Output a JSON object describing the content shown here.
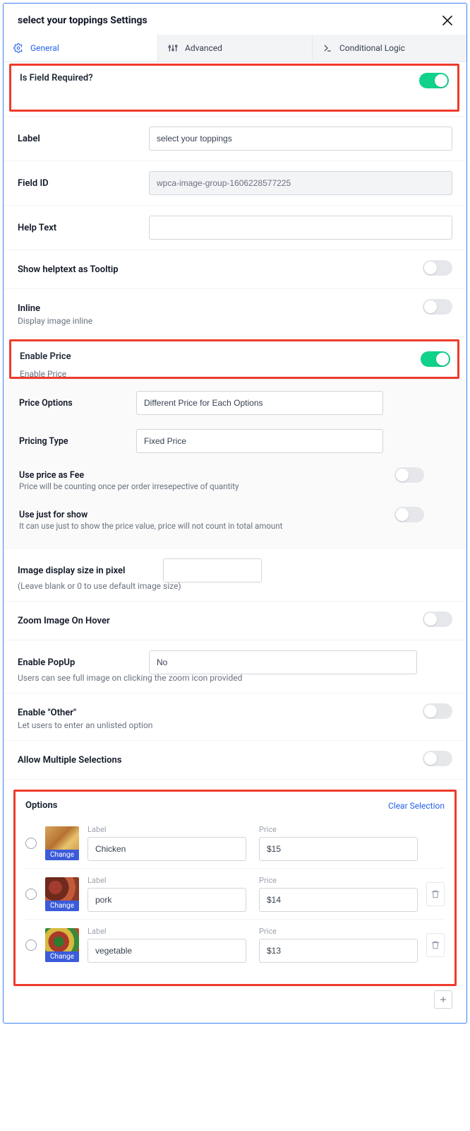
{
  "header": {
    "title": "select your toppings Settings"
  },
  "tabs": {
    "general": "General",
    "advanced": "Advanced",
    "conditional": "Conditional Logic"
  },
  "fields": {
    "required_label": "Is Field Required?",
    "required_on": true,
    "label_label": "Label",
    "label_value": "select your toppings",
    "fieldid_label": "Field ID",
    "fieldid_value": "wpca-image-group-1606228577225",
    "helptext_label": "Help Text",
    "helptext_value": "",
    "tooltip_label": "Show helptext as Tooltip",
    "tooltip_on": false,
    "inline_label": "Inline",
    "inline_help": "Display image inline",
    "inline_on": false,
    "enableprice_label": "Enable Price",
    "enableprice_help": "Enable Price",
    "enableprice_on": true,
    "price_options_label": "Price Options",
    "price_options_value": "Different Price for Each Options",
    "pricing_type_label": "Pricing Type",
    "pricing_type_value": "Fixed Price",
    "use_fee_label": "Use price as Fee",
    "use_fee_help": "Price will be counting once per order irresepective of quantity",
    "use_fee_on": false,
    "just_show_label": "Use just for show",
    "just_show_help": "It can use just to show the price value, price will not count in total amount",
    "just_show_on": false,
    "imgsize_label": "Image display size in pixel",
    "imgsize_help": "(Leave blank or 0 to use default image size)",
    "imgsize_value": "",
    "zoom_label": "Zoom Image On Hover",
    "zoom_on": false,
    "popup_label": "Enable PopUp",
    "popup_value": "No",
    "popup_help": "Users can see full image on clicking the zoom icon provided",
    "other_label": "Enable \"Other\"",
    "other_help": "Let users to enter an unlisted option",
    "other_on": false,
    "multi_label": "Allow Multiple Selections",
    "multi_on": false
  },
  "options_section": {
    "title": "Options",
    "clear": "Clear Selection",
    "label_col": "Label",
    "price_col": "Price",
    "change": "Change",
    "items": [
      {
        "label": "Chicken",
        "price": "$15"
      },
      {
        "label": "pork",
        "price": "$14"
      },
      {
        "label": "vegetable",
        "price": "$13"
      }
    ]
  }
}
